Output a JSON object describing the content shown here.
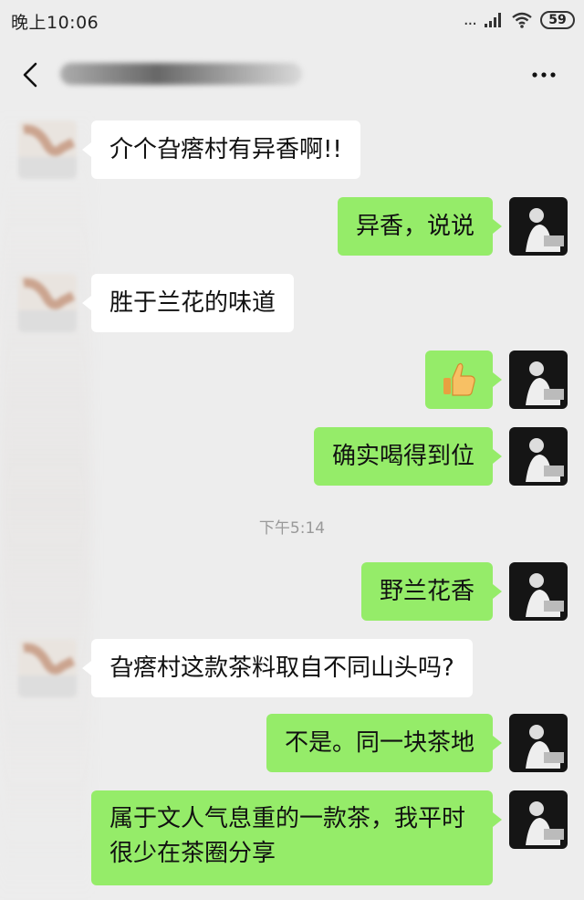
{
  "status_bar": {
    "time": "晚上10:06",
    "signal_dots": "...",
    "battery": "59"
  },
  "header": {
    "contact_name": ""
  },
  "messages": [
    {
      "side": "left",
      "text": "介个旮瘩村有异香啊!!"
    },
    {
      "side": "right",
      "text": "异香，说说"
    },
    {
      "side": "left",
      "text": "胜于兰花的味道"
    },
    {
      "side": "right",
      "text": "👍"
    },
    {
      "side": "right",
      "text": "确实喝得到位"
    },
    {
      "timestamp": "下午5:14"
    },
    {
      "side": "right",
      "text": "野兰花香"
    },
    {
      "side": "left",
      "text": "旮瘩村这款茶料取自不同山头吗?"
    },
    {
      "side": "right",
      "text": "不是。同一块茶地"
    },
    {
      "side": "right",
      "text": "属于文人气息重的一款茶，我平时很少在茶圈分享"
    }
  ],
  "colors": {
    "background": "#ededed",
    "bubble_sent": "#95ec69",
    "bubble_received": "#ffffff",
    "timestamp": "#999999"
  },
  "icons": {
    "back": "chevron-left-icon",
    "more": "more-horizontal-icon",
    "wifi": "wifi-icon",
    "signal": "signal-icon",
    "battery": "battery-icon"
  }
}
